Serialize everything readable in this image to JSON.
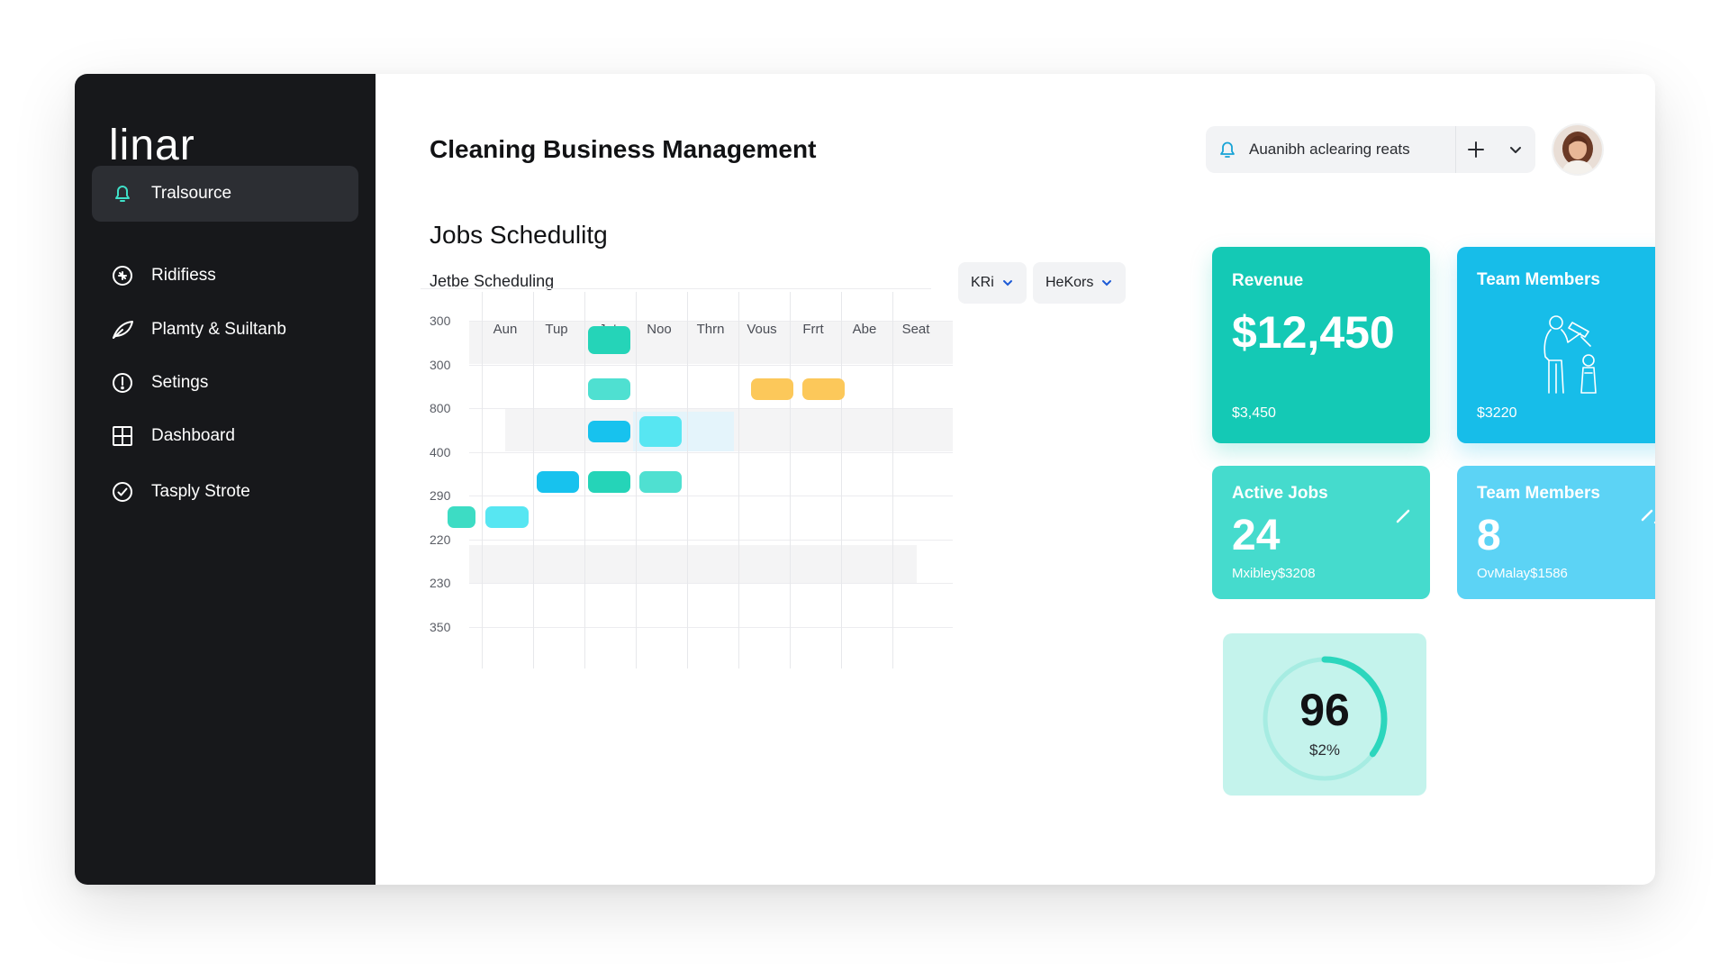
{
  "app": {
    "logo": "linar",
    "page_title": "Cleaning Business Management"
  },
  "sidebar": {
    "items": [
      {
        "label": "Tralsource",
        "icon": "bell-icon",
        "active": true
      },
      {
        "label": "Ridifiess",
        "icon": "gauge-icon",
        "active": false
      },
      {
        "label": "Plamty & Suiltanb",
        "icon": "leaf-icon",
        "active": false
      },
      {
        "label": "Setings",
        "icon": "info-circle-icon",
        "active": false
      },
      {
        "label": "Dashboard",
        "icon": "grid-icon",
        "active": false
      },
      {
        "label": "Tasply Strote",
        "icon": "check-circle-icon",
        "active": false
      }
    ]
  },
  "header": {
    "notification_text": "Auanibh aclearing reats",
    "notification_icon": "bell-icon",
    "add_icon": "plus-icon",
    "menu_icon": "chevron-down-icon",
    "avatar_icon": "user-avatar"
  },
  "schedule": {
    "title": "Jobs Schedulitg",
    "subtitle": "Jetbe Scheduling",
    "filters": [
      {
        "label": "KRi"
      },
      {
        "label": "HeKors"
      }
    ],
    "days": [
      "Aun",
      "Tup",
      "Jut",
      "Noo",
      "Thrn",
      "Vous",
      "Frrt",
      "Abe",
      "Seat"
    ],
    "rows": [
      "300",
      "300",
      "800",
      "400",
      "290",
      "220",
      "230",
      "350"
    ],
    "jobs": [
      {
        "day": 3,
        "row": 0,
        "color": "#25d4b8"
      },
      {
        "day": 3,
        "row": 1,
        "color": "#4fe0d1"
      },
      {
        "day": 6,
        "row": 1,
        "color": "#fcc85a"
      },
      {
        "day": 7,
        "row": 1,
        "color": "#fcc85a"
      },
      {
        "day": 3,
        "row": 2,
        "color": "#17c2ee"
      },
      {
        "day": 4,
        "row": 2,
        "color": "#57e6f2"
      },
      {
        "day": 2,
        "row": 3,
        "color": "#17c2ee"
      },
      {
        "day": 3,
        "row": 3,
        "color": "#25d4b8"
      },
      {
        "day": 4,
        "row": 3,
        "color": "#4fe0d1"
      },
      {
        "day": 0,
        "row": 4,
        "color": "#3ddcc4"
      },
      {
        "day": 1,
        "row": 4,
        "color": "#57e6f2"
      }
    ]
  },
  "cards": {
    "revenue": {
      "title": "Revenue",
      "value": "$12,450",
      "sub": "$3,450",
      "color": "#14c9b5"
    },
    "team": {
      "title": "Team Members",
      "sub": "$3220",
      "illustration": "cleaner-icon",
      "color": "#17bde9"
    },
    "active_jobs": {
      "title": "Active Jobs",
      "value": "24",
      "sub": "Mxibley$3208",
      "icon": "edit-icon",
      "color": "#45dbcd"
    },
    "team_count": {
      "title": "Team Members",
      "value": "8",
      "sub": "OvMalay$1586",
      "icon": "edit-icon",
      "color": "#5cd3f5"
    }
  },
  "gauge": {
    "value": "96",
    "sub": "$2%",
    "progress": 0.35,
    "color": "#2cd6bd"
  }
}
